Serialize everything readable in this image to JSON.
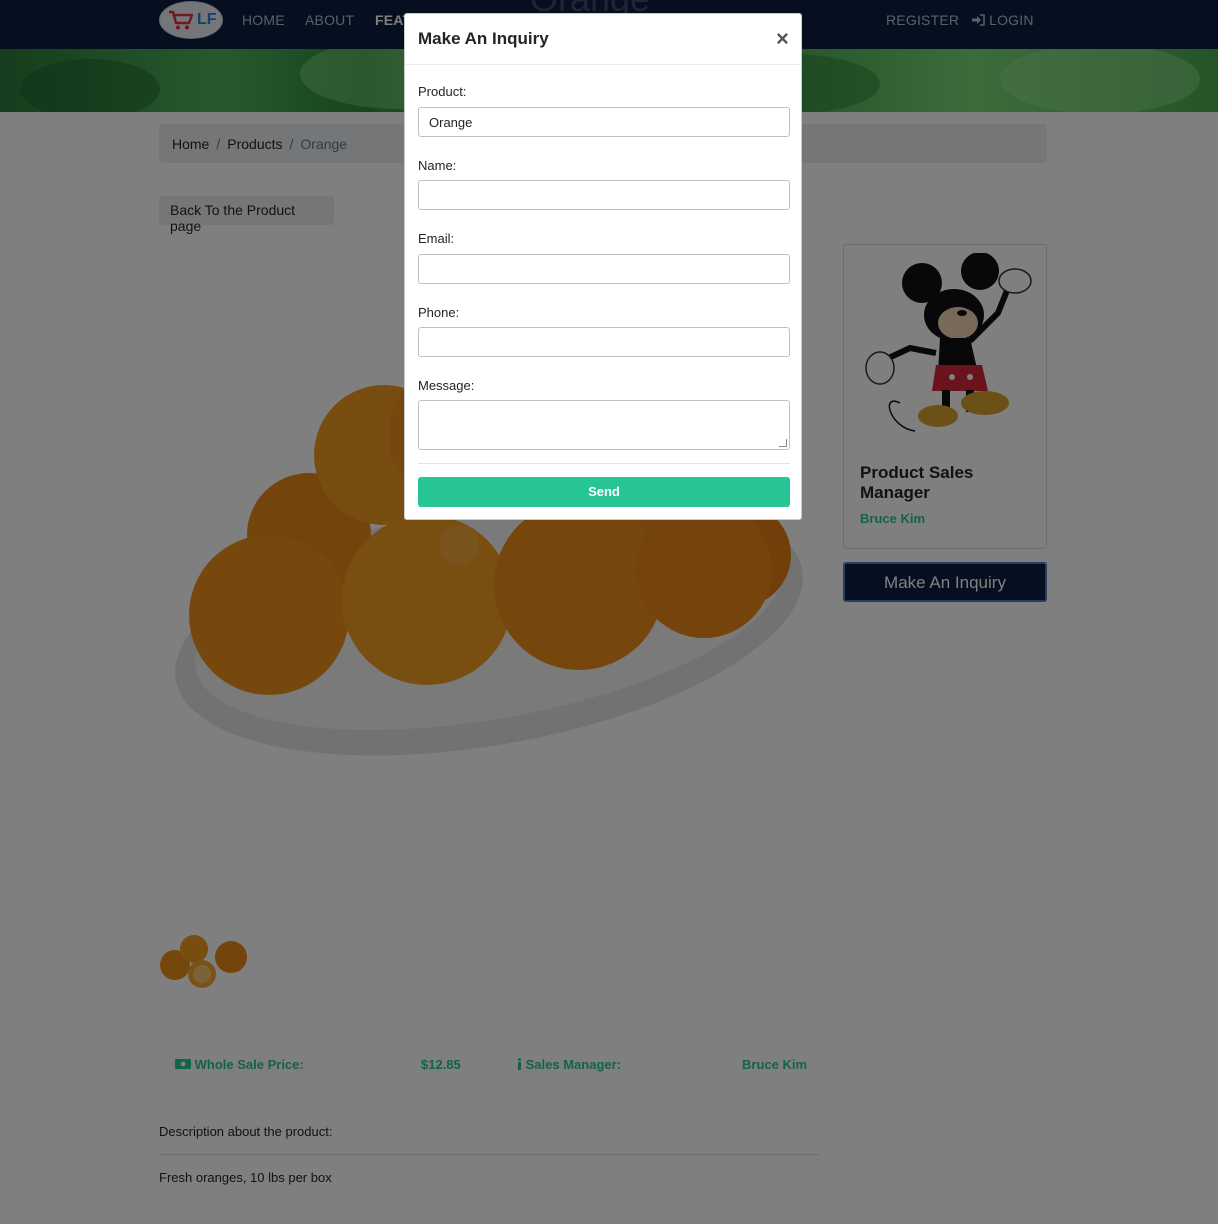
{
  "nav": {
    "brand": "LF",
    "items": [
      "HOME",
      "ABOUT",
      "FEAT"
    ],
    "register": "REGISTER",
    "login": "LOGIN",
    "page_heading": "Orange"
  },
  "breadcrumb": {
    "home": "Home",
    "products": "Products",
    "current": "Orange",
    "separator": "/"
  },
  "back_button": "Back To the Product page",
  "manager_card": {
    "role": "Product Sales Manager",
    "name": "Bruce Kim"
  },
  "inquiry_button": "Make An Inquiry",
  "info": {
    "price_label": "Whole Sale Price:",
    "price_value": "$12.85",
    "manager_label": "Sales Manager:",
    "manager_value": "Bruce Kim"
  },
  "description": {
    "title": "Description about the product:",
    "text": "Fresh oranges, 10 lbs per box"
  },
  "modal": {
    "title": "Make An Inquiry",
    "close": "×",
    "product_label": "Product:",
    "product_value": "Orange",
    "name_label": "Name:",
    "email_label": "Email:",
    "phone_label": "Phone:",
    "message_label": "Message:",
    "send": "Send"
  },
  "colors": {
    "navy": "#0b1f3f",
    "accent": "#27c495",
    "backdrop": "rgba(0,0,0,0.5)"
  }
}
